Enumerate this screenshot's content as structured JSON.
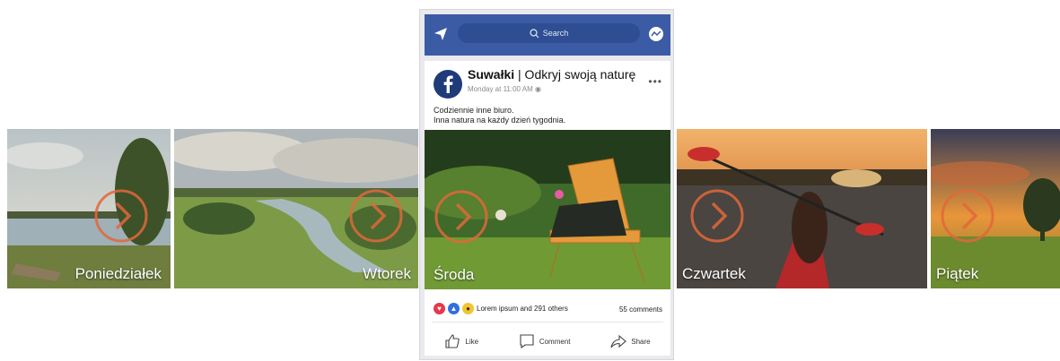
{
  "days": [
    {
      "label": "Poniedziałek"
    },
    {
      "label": "Wtorek"
    },
    {
      "label": "Środa"
    },
    {
      "label": "Czwartek"
    },
    {
      "label": "Piątek"
    }
  ],
  "post": {
    "search_placeholder": "Search",
    "page_name_bold": "Suwałki",
    "page_name_rest": " | Odkryj swoją naturę",
    "timestamp": "Monday at 11:00 AM",
    "caption_line1": "Codziennie inne biuro.",
    "caption_line2": "Inna natura na każdy dzień tygodnia.",
    "reactions_text": "Lorem ipsum and  291 others",
    "comments_text": "55 comments",
    "like_label": "Like",
    "comment_label": "Comment",
    "share_label": "Share"
  },
  "colors": {
    "fb_header": "#3b5ba5",
    "play_ring": "#e2673a"
  }
}
